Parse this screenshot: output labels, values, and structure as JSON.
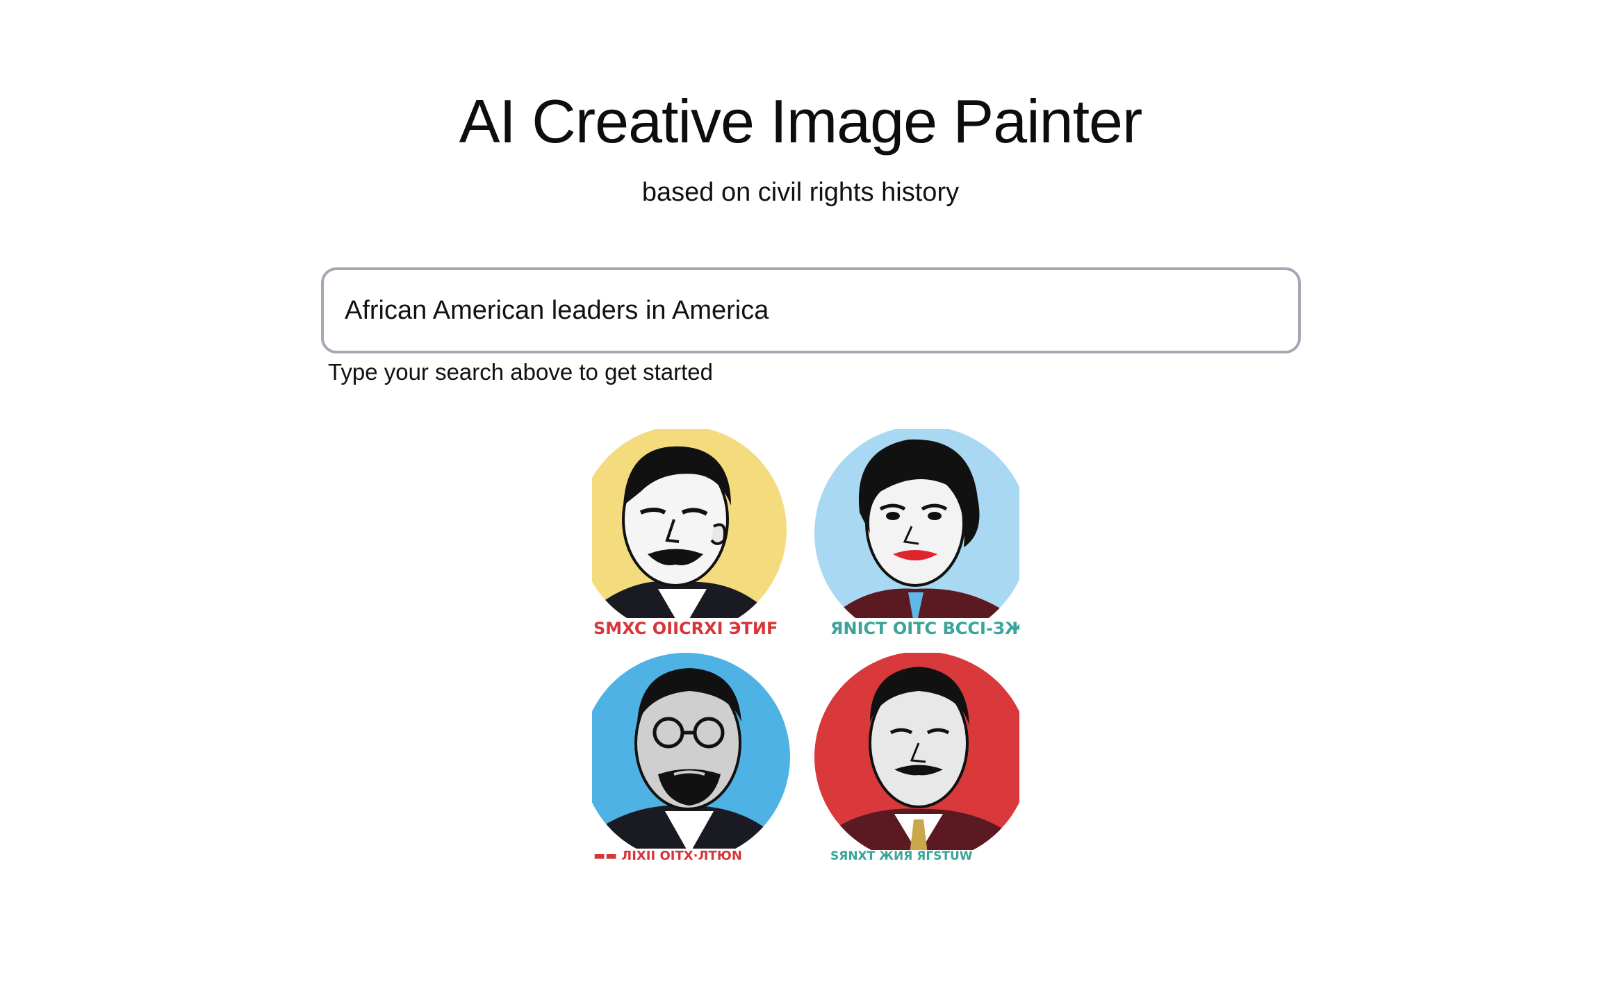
{
  "header": {
    "title": "AI Creative Image Painter",
    "subtitle": "based on civil rights history"
  },
  "search": {
    "value": "African American leaders in America",
    "helper_text": "Type your search above to get started"
  },
  "results": {
    "images": [
      {
        "name": "portrait-yellow",
        "background_color": "#f4dc7e",
        "caption_color": "#d8353a"
      },
      {
        "name": "portrait-light-blue",
        "background_color": "#a9d8f2",
        "caption_color": "#3aa39a"
      },
      {
        "name": "portrait-blue",
        "background_color": "#4fb2e4",
        "caption_color": "#d8353a"
      },
      {
        "name": "portrait-red",
        "background_color": "#d9393a",
        "caption_color": "#3aa39a"
      }
    ]
  }
}
